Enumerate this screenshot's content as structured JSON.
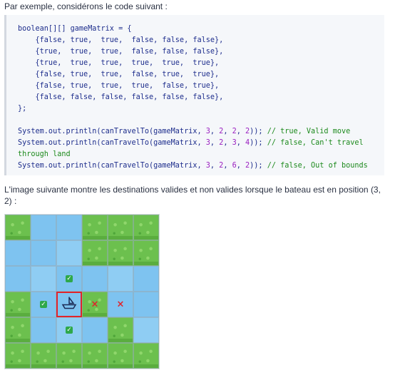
{
  "intro_text": "Par exemple, considérons le code suivant :",
  "code": {
    "declaration": "boolean[][] gameMatrix = {",
    "rows": [
      "    {false, true,  true,  false, false, false},",
      "    {true,  true,  true,  false, false, false},",
      "    {true,  true,  true,  true,  true,  true},",
      "    {false, true,  true,  false, true,  true},",
      "    {false, true,  true,  true,  false, true},",
      "    {false, false, false, false, false, false},"
    ],
    "closing": "};",
    "calls": [
      {
        "prefix": "System.out.println(canTravelTo(gameMatrix, ",
        "args": [
          "3",
          "2",
          "2",
          "2"
        ],
        "suffix": ")); ",
        "comment": "// true, Valid move"
      },
      {
        "prefix": "System.out.println(canTravelTo(gameMatrix, ",
        "args": [
          "3",
          "2",
          "3",
          "4"
        ],
        "suffix": ")); ",
        "comment": "// false, Can't travel"
      },
      {
        "prefix": "",
        "args": [],
        "suffix": "",
        "comment": "through land"
      },
      {
        "prefix": "System.out.println(canTravelTo(gameMatrix, ",
        "args": [
          "3",
          "2",
          "6",
          "2"
        ],
        "suffix": ")); ",
        "comment": "// false, Out of bounds"
      }
    ]
  },
  "caption_text": "L'image suivante montre les destinations valides et non valides lorsque le bateau est en position (3, 2) :",
  "grid": {
    "rows": [
      [
        "land",
        "water",
        "water",
        "land",
        "land",
        "land"
      ],
      [
        "water",
        "water",
        "water",
        "land",
        "land",
        "land"
      ],
      [
        "water",
        "water",
        "water",
        "water",
        "water",
        "water"
      ],
      [
        "land",
        "water",
        "water",
        "land",
        "water",
        "water"
      ],
      [
        "land",
        "water",
        "water",
        "water",
        "land",
        "water"
      ],
      [
        "land",
        "land",
        "land",
        "land",
        "land",
        "land"
      ]
    ],
    "markers": [
      {
        "row": 2,
        "col": 2,
        "kind": "valid"
      },
      {
        "row": 3,
        "col": 1,
        "kind": "valid"
      },
      {
        "row": 3,
        "col": 2,
        "kind": "boat"
      },
      {
        "row": 3,
        "col": 3,
        "kind": "invalid"
      },
      {
        "row": 3,
        "col": 4,
        "kind": "invalid"
      },
      {
        "row": 4,
        "col": 2,
        "kind": "valid"
      }
    ],
    "colors": {
      "land": "#6cc04e",
      "water": "#7ec3f0",
      "valid": "#2ea84a",
      "invalid": "#e0242b"
    },
    "valid_glyph": "✓",
    "invalid_glyph": "×"
  }
}
